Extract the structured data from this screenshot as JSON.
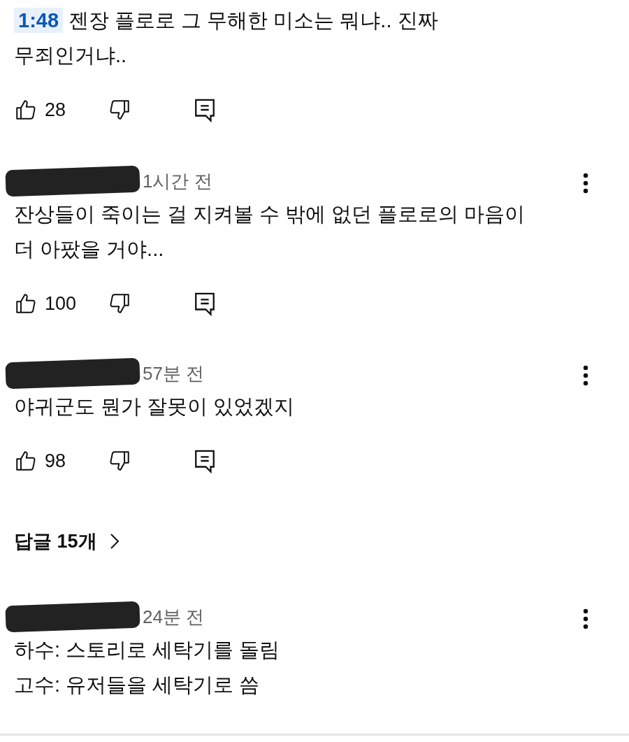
{
  "comments": [
    {
      "timestamp": "1:48",
      "lines": [
        "젠장 플로로 그 무해한 미소는 뭐냐.. 진짜",
        "무죄인거냐.."
      ],
      "likes": "28"
    },
    {
      "time": "1시간 전",
      "lines": [
        "잔상들이 죽이는 걸 지켜볼 수 밖에 없던 플로로의 마음이",
        "더 아팠을 거야..."
      ],
      "likes": "100"
    },
    {
      "time": "57분 전",
      "lines": [
        "야귀군도 뭔가 잘못이 있었겠지"
      ],
      "likes": "98",
      "replies": "답글 15개"
    },
    {
      "time": "24분 전",
      "lines": [
        "하수: 스토리로 세탁기를 돌림",
        "고수: 유저들을 세탁기로 씀"
      ]
    }
  ]
}
